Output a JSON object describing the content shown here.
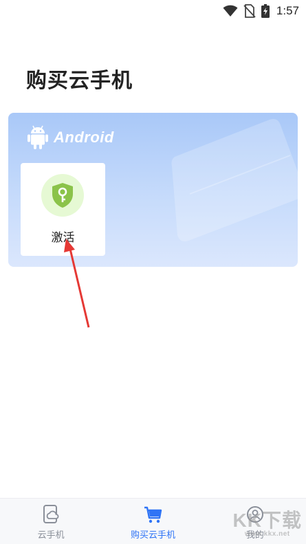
{
  "status_bar": {
    "time": "1:57",
    "icons": [
      "wifi-icon",
      "no-sim-icon",
      "battery-charging-icon"
    ]
  },
  "page": {
    "title": "购买云手机"
  },
  "android_card": {
    "label": "Android",
    "activate_label": "激活",
    "icon": "shield-key-icon",
    "colors": {
      "card_top": "#a9c8f8",
      "card_bottom": "#dbe7fd",
      "shield": "#8bc34a",
      "shield_bg": "#e6f9d4"
    }
  },
  "annotation": {
    "icon": "red-arrow-icon",
    "color": "#e53935"
  },
  "bottom_nav": {
    "items": [
      {
        "label": "云手机",
        "icon": "cloud-phone-icon",
        "active": false
      },
      {
        "label": "购买云手机",
        "icon": "cart-icon",
        "active": true
      },
      {
        "label": "我的",
        "icon": "profile-icon",
        "active": false
      }
    ],
    "active_color": "#2f74f5"
  },
  "watermark": {
    "text": "KK下载",
    "url": "www.kkx.net"
  }
}
